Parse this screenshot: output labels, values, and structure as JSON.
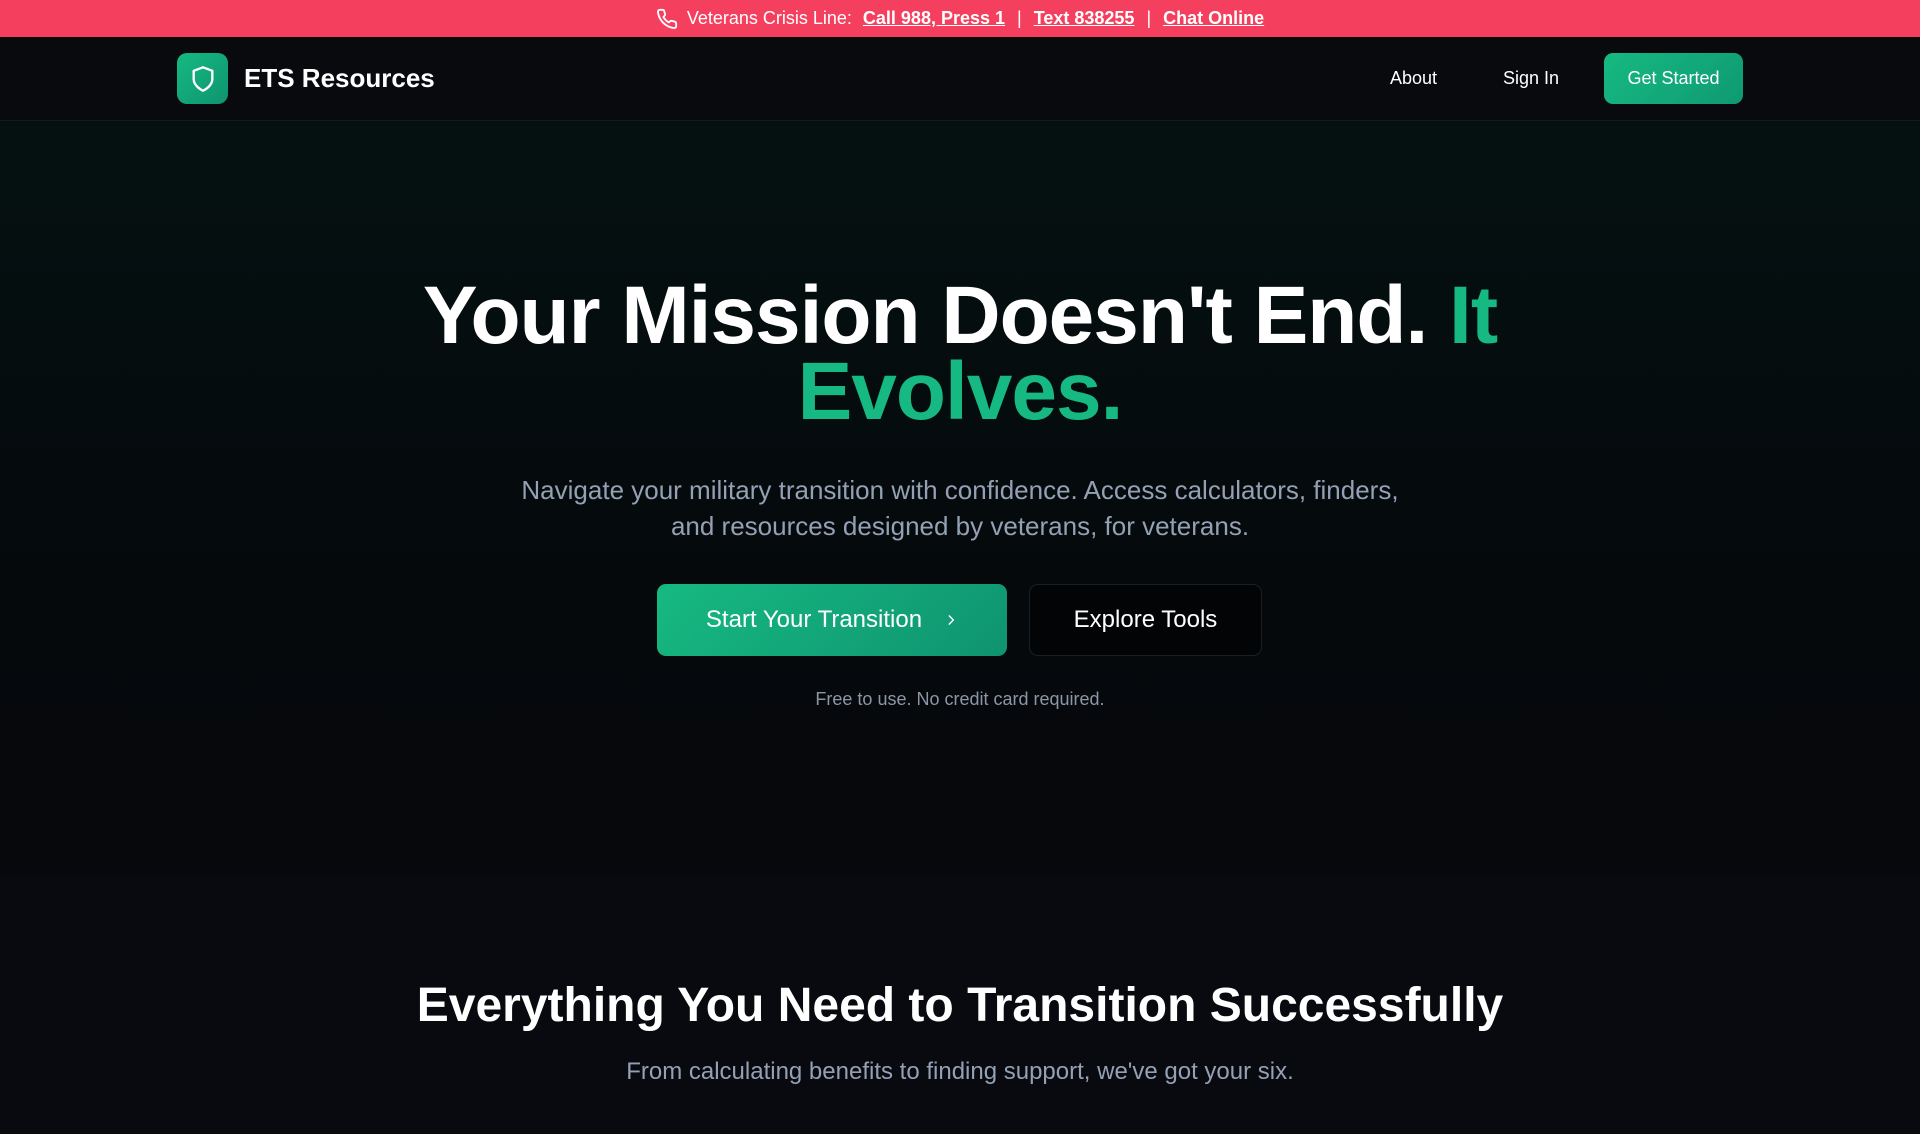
{
  "crisis_bar": {
    "label": "Veterans Crisis Line:",
    "call_link": "Call 988, Press 1",
    "text_link": "Text 838255",
    "chat_link": "Chat Online",
    "separator": "|",
    "icon": "phone-icon",
    "background_color": "#f43f5e"
  },
  "navbar": {
    "brand": "ETS Resources",
    "logo_icon": "shield-icon",
    "about_label": "About",
    "signin_label": "Sign In",
    "cta_label": "Get Started",
    "accent_color": "#16b981"
  },
  "hero": {
    "title_main": "Your Mission Doesn't End.",
    "title_accent": "It Evolves.",
    "subtitle": "Navigate your military transition with confidence. Access calculators, finders, and resources designed by veterans, for veterans.",
    "primary_button": "Start Your Transition",
    "primary_button_icon": "chevron-right-icon",
    "secondary_button": "Explore Tools",
    "note": "Free to use. No credit card required."
  },
  "features": {
    "title": "Everything You Need to Transition Successfully",
    "subtitle": "From calculating benefits to finding support, we've got your six."
  }
}
